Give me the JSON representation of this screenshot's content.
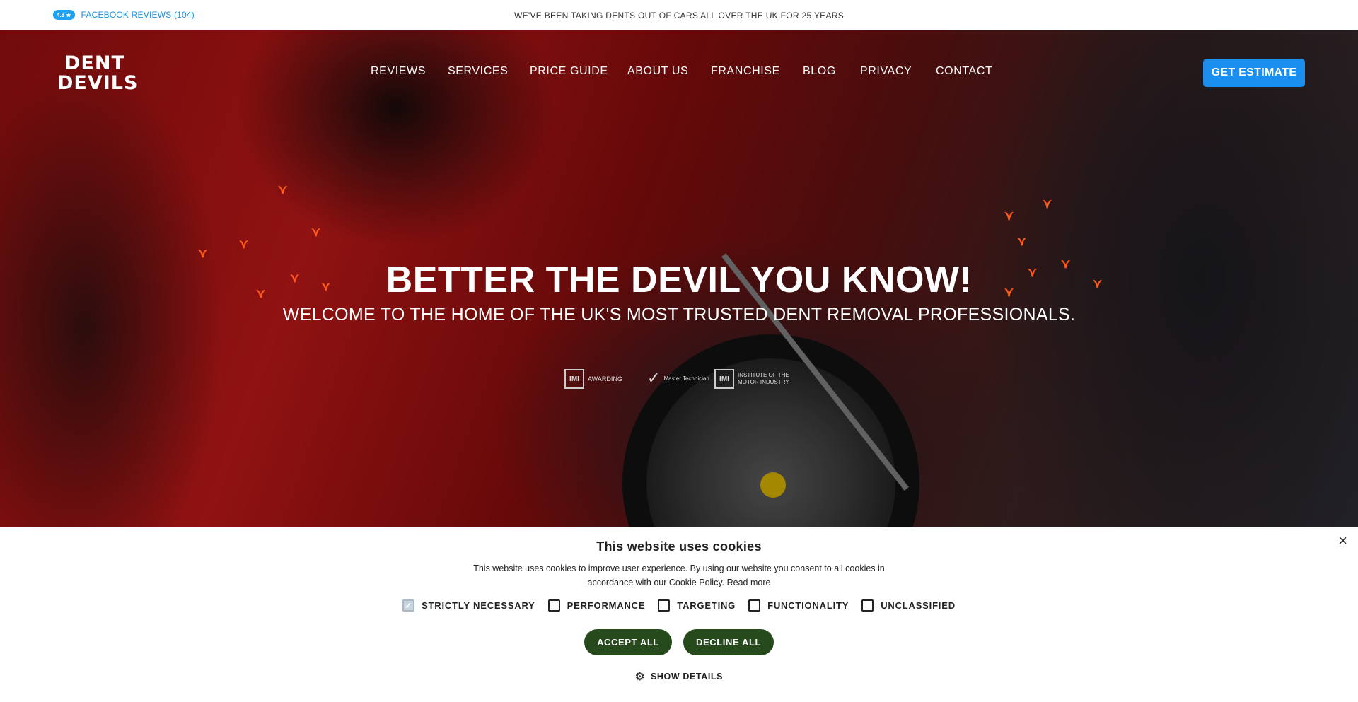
{
  "topbar": {
    "rating_badge": "4.8 ★",
    "facebook_reviews": "FACEBOOK REVIEWS (104)",
    "tagline": "WE'VE BEEN TAKING DENTS OUT OF CARS ALL OVER THE UK FOR 25 YEARS"
  },
  "header": {
    "logo_line1": "DENT",
    "logo_line2": "DEVILS",
    "nav": [
      "REVIEWS",
      "SERVICES",
      "PRICE GUIDE",
      "ABOUT US",
      "FRANCHISE",
      "BLOG",
      "PRIVACY",
      "CONTACT"
    ],
    "estimate_label": "GET ESTIMATE"
  },
  "hero": {
    "headline": "BETTER THE DEVIL YOU KNOW!",
    "subline": "WELCOME TO THE HOME OF THE UK'S MOST TRUSTED DENT REMOVAL PROFESSIONALS.",
    "badges": [
      {
        "mark": "IMI",
        "text": "AWARDING"
      },
      {
        "mark": "✓",
        "text": "Master Technician"
      },
      {
        "mark": "IMI",
        "text": "INSTITUTE OF THE MOTOR INDUSTRY"
      }
    ]
  },
  "cookie": {
    "title": "This website uses cookies",
    "text": "This website uses cookies to improve user experience. By using our website you consent to all cookies in accordance with our Cookie Policy.",
    "read_more": "Read more",
    "options": [
      {
        "label": "STRICTLY NECESSARY",
        "checked": true
      },
      {
        "label": "PERFORMANCE",
        "checked": false
      },
      {
        "label": "TARGETING",
        "checked": false
      },
      {
        "label": "FUNCTIONALITY",
        "checked": false
      },
      {
        "label": "UNCLASSIFIED",
        "checked": false
      }
    ],
    "accept_label": "ACCEPT ALL",
    "decline_label": "DECLINE ALL",
    "details_label": "SHOW DETAILS",
    "close_symbol": "×"
  },
  "colors": {
    "accent_blue": "#1a8ff0",
    "cookie_button_green": "#264a1b",
    "devil_orange": "#e8421a"
  }
}
